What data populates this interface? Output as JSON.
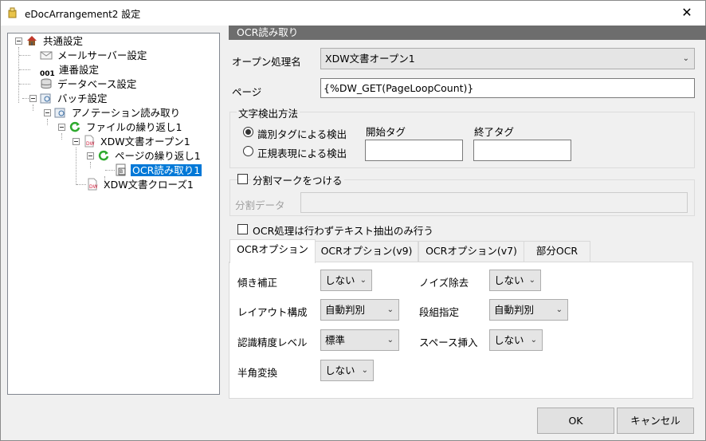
{
  "window": {
    "title": "eDocArrangement2 設定",
    "close_glyph": "✕"
  },
  "tree": [
    {
      "label": "共通設定",
      "icon": "house-icon"
    },
    {
      "label": "メールサーバー設定",
      "icon": "mail-icon"
    },
    {
      "label": "連番設定",
      "icon": "serial-number-icon",
      "icon_text": "001"
    },
    {
      "label": "データベース設定",
      "icon": "database-icon"
    },
    {
      "label": "バッチ設定",
      "icon": "batch-icon"
    },
    {
      "label": "アノテーション読み取り",
      "icon": "annotation-icon"
    },
    {
      "label": "ファイルの繰り返し1",
      "icon": "loop-icon"
    },
    {
      "label": "XDW文書オープン1",
      "icon": "dw-document-icon"
    },
    {
      "label": "ページの繰り返し1",
      "icon": "loop-icon"
    },
    {
      "label": "OCR読み取り1",
      "icon": "ocr-icon",
      "selected": true
    },
    {
      "label": "XDW文書クローズ1",
      "icon": "dw-document-icon"
    }
  ],
  "section_title": "OCR読み取り",
  "form": {
    "open_label": "オープン処理名",
    "open_value": "XDW文書オープン1",
    "page_label": "ページ",
    "page_value": "{%DW_GET(PageLoopCount)}",
    "detect_group": "文字検出方法",
    "radio_tag": "識別タグによる検出",
    "radio_regex": "正規表現による検出",
    "start_tag_label": "開始タグ",
    "end_tag_label": "終了タグ",
    "start_tag_value": "",
    "end_tag_value": "",
    "split_mark_label": "分割マークをつける",
    "split_data_label": "分割データ",
    "split_data_value": "",
    "text_only_label": "OCR処理は行わずテキスト抽出のみ行う"
  },
  "tabs": [
    "OCRオプション",
    "OCRオプション(v9)",
    "OCRオプション(v7)",
    "部分OCR"
  ],
  "ocr_options": {
    "skew_label": "傾き補正",
    "skew_value": "しない",
    "noise_label": "ノイズ除去",
    "noise_value": "しない",
    "layout_label": "レイアウト構成",
    "layout_value": "自動判別",
    "column_label": "段組指定",
    "column_value": "自動判別",
    "accuracy_label": "認識精度レベル",
    "accuracy_value": "標準",
    "space_label": "スペース挿入",
    "space_value": "しない",
    "halfwidth_label": "半角変換",
    "halfwidth_value": "しない"
  },
  "buttons": {
    "ok": "OK",
    "cancel": "キャンセル"
  },
  "colors": {
    "selection": "#0078d7",
    "header": "#6d6d6d"
  }
}
